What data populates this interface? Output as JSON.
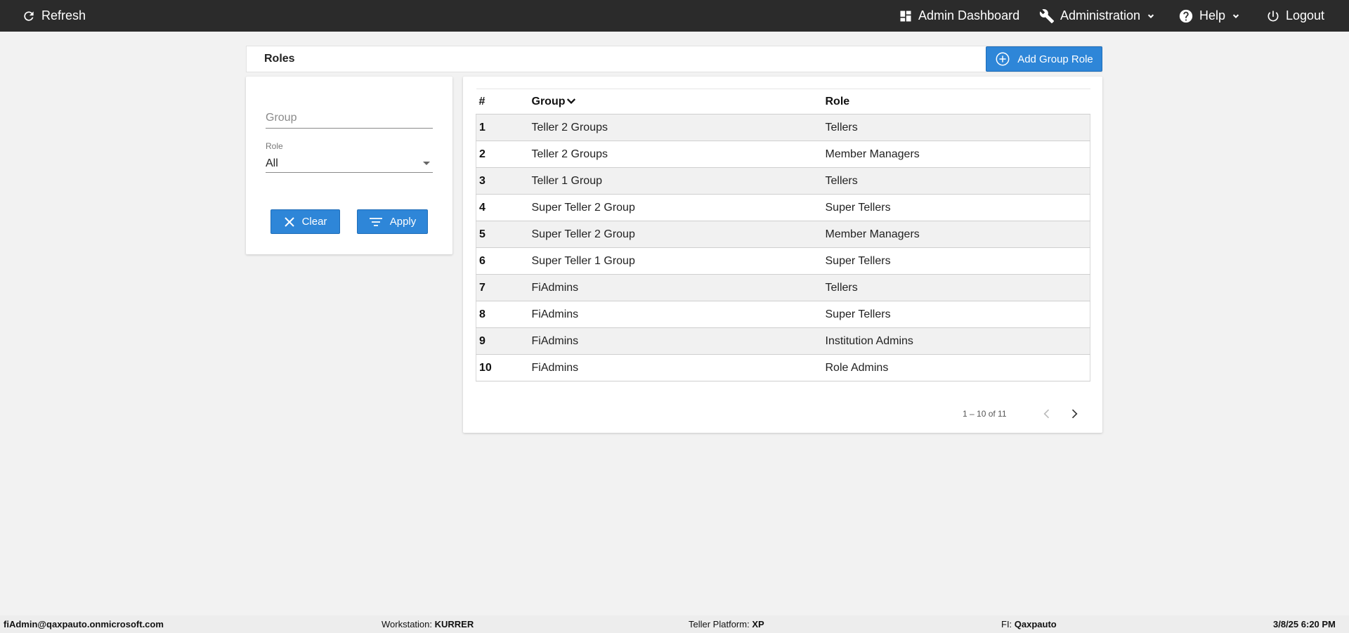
{
  "topbar": {
    "refresh_label": "Refresh",
    "admin_dashboard_label": "Admin Dashboard",
    "administration_label": "Administration",
    "help_label": "Help",
    "logout_label": "Logout"
  },
  "header": {
    "title": "Roles",
    "add_button_label": "Add Group Role"
  },
  "filter": {
    "group_placeholder": "Group",
    "group_value": "",
    "role_label": "Role",
    "role_value": "All",
    "clear_label": "Clear",
    "apply_label": "Apply"
  },
  "table": {
    "columns": [
      "#",
      "Group",
      "Role"
    ],
    "rows": [
      {
        "num": "1",
        "group": "Teller 2 Groups",
        "role": "Tellers"
      },
      {
        "num": "2",
        "group": "Teller 2 Groups",
        "role": "Member Managers"
      },
      {
        "num": "3",
        "group": "Teller 1 Group",
        "role": "Tellers"
      },
      {
        "num": "4",
        "group": "Super Teller 2 Group",
        "role": "Super Tellers"
      },
      {
        "num": "5",
        "group": "Super Teller 2 Group",
        "role": "Member Managers"
      },
      {
        "num": "6",
        "group": "Super Teller 1 Group",
        "role": "Super Tellers"
      },
      {
        "num": "7",
        "group": "FiAdmins",
        "role": "Tellers"
      },
      {
        "num": "8",
        "group": "FiAdmins",
        "role": "Super Tellers"
      },
      {
        "num": "9",
        "group": "FiAdmins",
        "role": "Institution Admins"
      },
      {
        "num": "10",
        "group": "FiAdmins",
        "role": "Role Admins"
      }
    ],
    "pager_text": "1 – 10 of 11"
  },
  "footer": {
    "user": "fiAdmin@qaxpauto.onmicrosoft.com",
    "workstation_label": "Workstation: ",
    "workstation_value": "KURRER",
    "teller_platform_label": "Teller Platform: ",
    "teller_platform_value": "XP",
    "fi_label": "FI: ",
    "fi_value": "Qaxpauto",
    "datetime": "3/8/25 6:20 PM"
  },
  "colors": {
    "topbar": "#2b2b2b",
    "button_blue": "#2e86d8",
    "background": "#f2f2f2"
  }
}
